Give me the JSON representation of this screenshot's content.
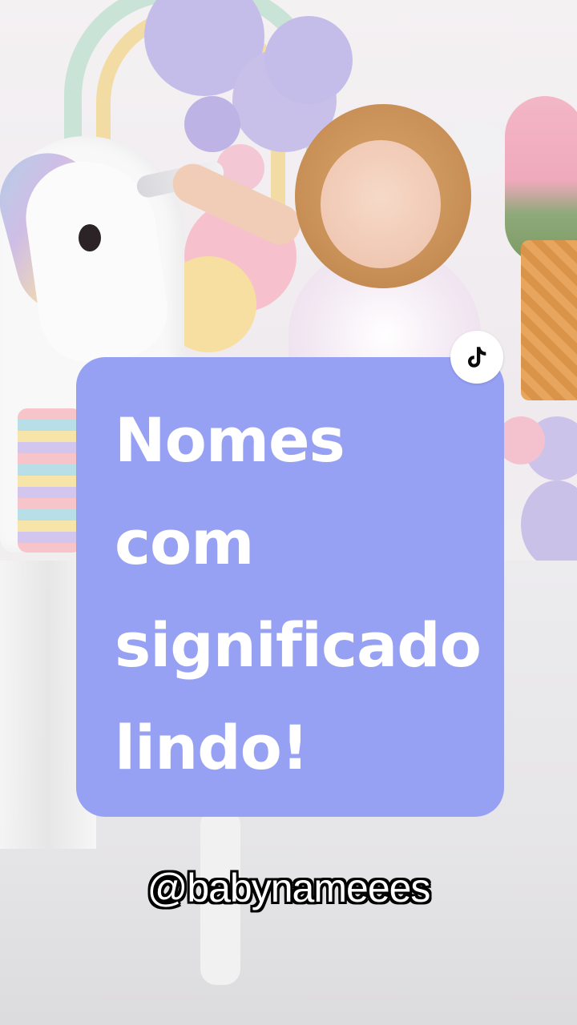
{
  "card": {
    "lines": [
      "Nomes",
      "com",
      "significado",
      "lindo!"
    ]
  },
  "handle": "@babynameees",
  "icons": {
    "badge": "tiktok-logo-icon"
  },
  "colors": {
    "card_background": "#97a1f4",
    "card_text": "#ffffff",
    "handle_text": "#ffffff",
    "handle_outline": "#000000"
  }
}
